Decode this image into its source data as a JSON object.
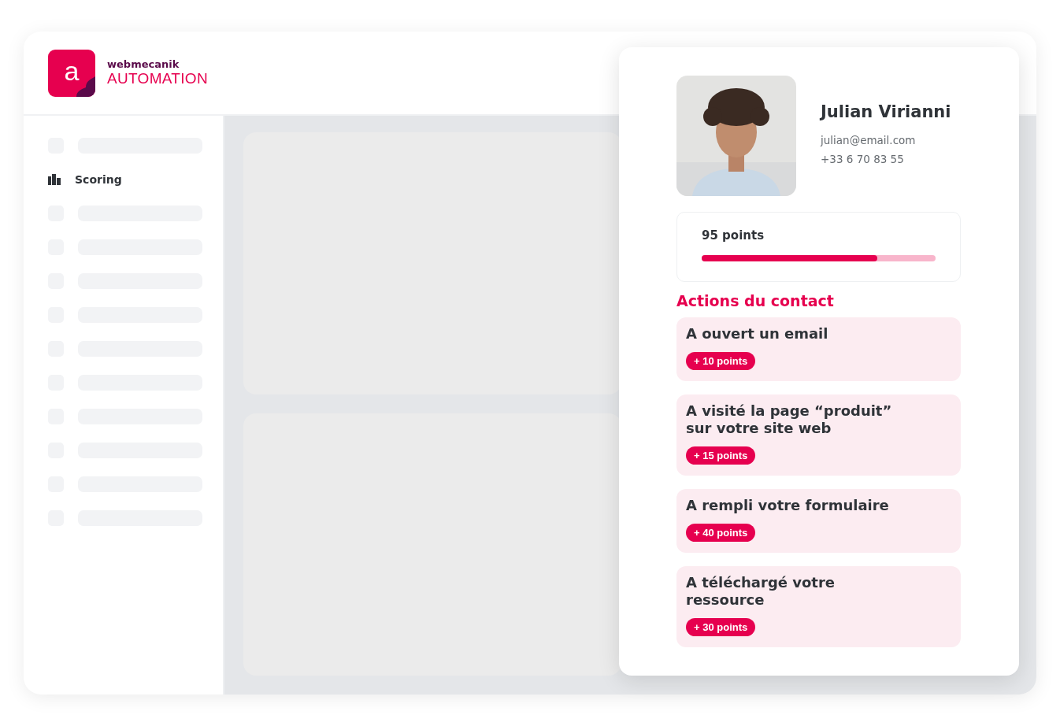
{
  "logo": {
    "brand": "webmecanik",
    "product": "AUTOMATION",
    "mark": "a"
  },
  "sidebar": {
    "items": [
      {
        "kind": "placeholder"
      },
      {
        "kind": "link",
        "label": "Scoring"
      },
      {
        "kind": "placeholder"
      },
      {
        "kind": "placeholder"
      },
      {
        "kind": "placeholder"
      },
      {
        "kind": "placeholder"
      },
      {
        "kind": "placeholder"
      },
      {
        "kind": "placeholder"
      },
      {
        "kind": "placeholder"
      },
      {
        "kind": "placeholder"
      },
      {
        "kind": "placeholder"
      },
      {
        "kind": "placeholder"
      }
    ]
  },
  "contact": {
    "name": "Julian Virianni",
    "email": "julian@email.com",
    "phone": "+33 6 70 83 55"
  },
  "score": {
    "label": "95 points",
    "level": 0.75
  },
  "actions": {
    "title": "Actions du contact",
    "items": [
      {
        "text": "A ouvert un email",
        "points": "+ 10 points"
      },
      {
        "text": "A visité la page “produit” sur votre site web",
        "points": "+ 15 points"
      },
      {
        "text": "A rempli votre formulaire",
        "points": "+ 40 points"
      },
      {
        "text": "A téléchargé votre ressource",
        "points": "+ 30 points"
      }
    ]
  }
}
